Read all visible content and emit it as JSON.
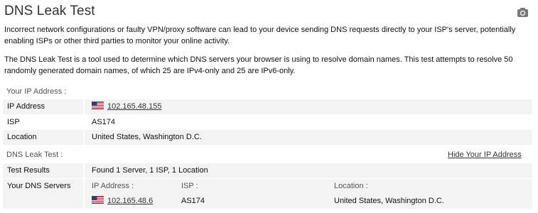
{
  "header": {
    "title": "DNS Leak Test",
    "camera_icon": "camera-icon"
  },
  "intro": {
    "paragraph1": "Incorrect network configurations or faulty VPN/proxy software can lead to your device sending DNS requests directly to your ISP's server, potentially enabling ISPs or other third parties to monitor your online activity.",
    "paragraph2": "The DNS Leak Test is a tool used to determine which DNS servers your browser is using to resolve domain names. This test attempts to resolve 50 randomly generated domain names, of which 25 are IPv4-only and 25 are IPv6-only."
  },
  "your_ip": {
    "section_label": "Your IP Address :",
    "rows": [
      {
        "key": "IP Address",
        "value": "102.165.48.155",
        "flag_icon": "us-flag-icon"
      },
      {
        "key": "ISP",
        "value": "AS174"
      },
      {
        "key": "Location",
        "value": "United States, Washington D.C."
      }
    ]
  },
  "dns_test": {
    "section_label": "DNS Leak Test :",
    "hide_link": "Hide Your IP Address",
    "test_results_key": "Test Results",
    "test_results_value": "Found 1 Server, 1 ISP, 1 Location",
    "servers_key": "Your DNS Servers",
    "columns": {
      "ip": "IP Address :",
      "isp": "ISP :",
      "location": "Location :"
    },
    "servers": [
      {
        "ip": "102.165.48.6",
        "isp": "AS174",
        "location": "United States, Washington D.C.",
        "flag_icon": "us-flag-icon"
      }
    ]
  },
  "colors": {
    "row_shade": "#f3f3f3",
    "text": "#111111",
    "muted": "#555555"
  }
}
